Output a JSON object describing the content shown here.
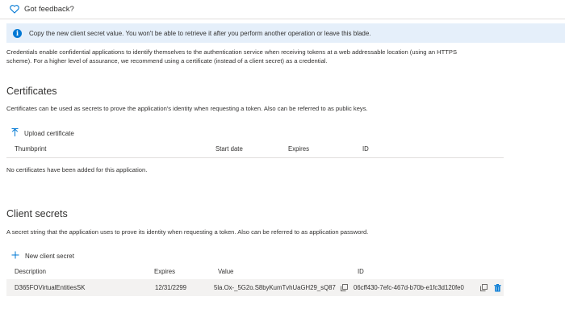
{
  "feedback": {
    "label": "Got feedback?"
  },
  "banner": {
    "icon": "info-icon",
    "text": "Copy the new client secret value. You won't be able to retrieve it after you perform another operation or leave this blade."
  },
  "intro": {
    "line1": "Credentials enable confidential applications to identify themselves to the authentication service when receiving tokens at a web addressable location (using an HTTPS",
    "line2": "scheme). For a higher level of assurance, we recommend using a certificate (instead of a client secret) as a credential."
  },
  "certificates": {
    "title": "Certificates",
    "description": "Certificates can be used as secrets to prove the application's identity when requesting a token. Also can be referred to as public keys.",
    "upload_label": "Upload certificate",
    "columns": [
      "Thumbprint",
      "Start date",
      "Expires",
      "ID"
    ],
    "empty_message": "No certificates have been added for this application."
  },
  "client_secrets": {
    "title": "Client secrets",
    "description": "A secret string that the application uses to prove its identity when requesting a token. Also can be referred to as application password.",
    "new_label": "New client secret",
    "columns": [
      "Description",
      "Expires",
      "Value",
      "ID"
    ],
    "rows": [
      {
        "description": "D365FOVirtualEntitiesSK",
        "expires": "12/31/2299",
        "value": "5la.Ox-_5G2o.S8byKumTvhUaGH29_sQ87",
        "id": "06cff430-7efc-467d-b70b-e1fc3d120fe0"
      }
    ]
  },
  "colors": {
    "accent": "#0078d4",
    "banner_bg": "#e5effa",
    "row_bg": "#f3f2f1"
  }
}
